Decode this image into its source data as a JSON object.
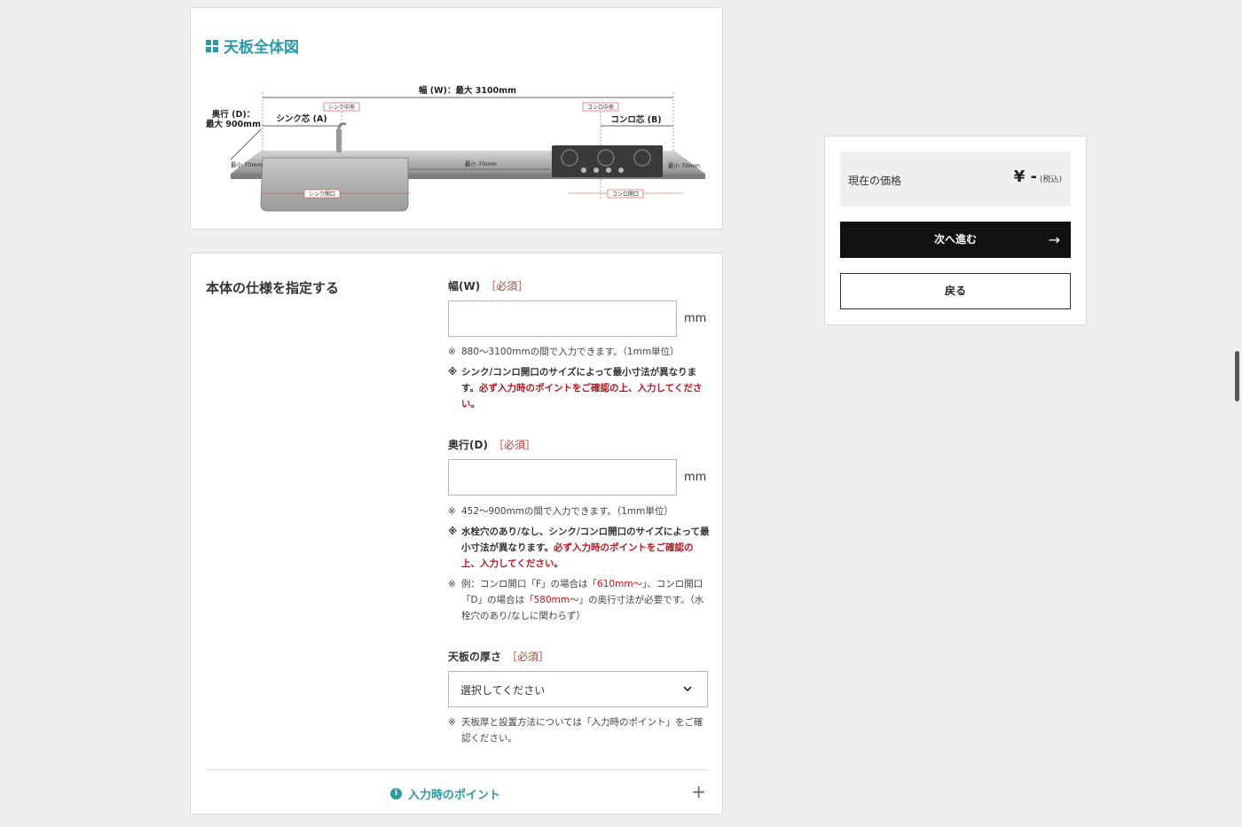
{
  "overview": {
    "title": "天板全体図",
    "diagram": {
      "width_label": "幅 (W)：最大 3100mm",
      "depth_label_1": "奥行 (D)：",
      "depth_label_2": "最大 900mm",
      "sink_center_tag": "シンク中央",
      "sink_core": "シンク芯 (A)",
      "stove_center_tag": "コンロ中央",
      "stove_core": "コンロ芯 (B)",
      "min_left": "最小 70mm",
      "min_mid": "最小 70mm",
      "min_right": "最小 70mm",
      "sink_opening": "シンク開口",
      "stove_opening": "コンロ開口"
    }
  },
  "spec": {
    "title": "本体の仕様を指定する",
    "required": "［必須］",
    "width": {
      "label": "幅(W)",
      "unit": "mm",
      "value": "",
      "note1": "880〜3100mmの間で入力できます。（1mm単位）",
      "note2_a": "シンク/コンロ開口のサイズによって最小寸法が異なります。",
      "note2_b": "必ず入力時のポイントをご確認の上、入力してください。"
    },
    "depth": {
      "label": "奥行(D)",
      "unit": "mm",
      "value": "",
      "note1": "452〜900mmの間で入力できます。（1mm単位）",
      "note2_a": "水栓穴のあり/なし、シンク/コンロ開口のサイズによって最小寸法が異なります。",
      "note2_b": "必ず入力時のポイントをご確認の上、入力してください。",
      "note3_a": "例：コンロ開口「F」の場合は",
      "note3_b": "「610mm〜」",
      "note3_c": "、コンロ開口「D」の場合は",
      "note3_d": "「580mm〜」",
      "note3_e": "の奥行寸法が必要です。（水栓穴のあり/なしに関わらず）"
    },
    "thickness": {
      "label": "天板の厚さ",
      "selected": "選択してください",
      "note": "天板厚と設置方法については「入力時のポイント」をご確認ください。"
    },
    "points": {
      "label": "入力時のポイント",
      "toggle": "+"
    },
    "note_mark": "※"
  },
  "panel": {
    "price_label": "現在の価格",
    "price_value": "¥ -",
    "tax": "(税込)",
    "next_label": "次へ進む",
    "back_label": "戻る"
  },
  "icons": {
    "title_icon": "grid-icon",
    "info_icon": "info-icon",
    "next_arrow": "arrow-right-icon",
    "select_chevron": "chevron-down-icon"
  },
  "colors": {
    "accent": "#2a9aa5",
    "required": "#c0141c",
    "primary_button": "#111111"
  }
}
